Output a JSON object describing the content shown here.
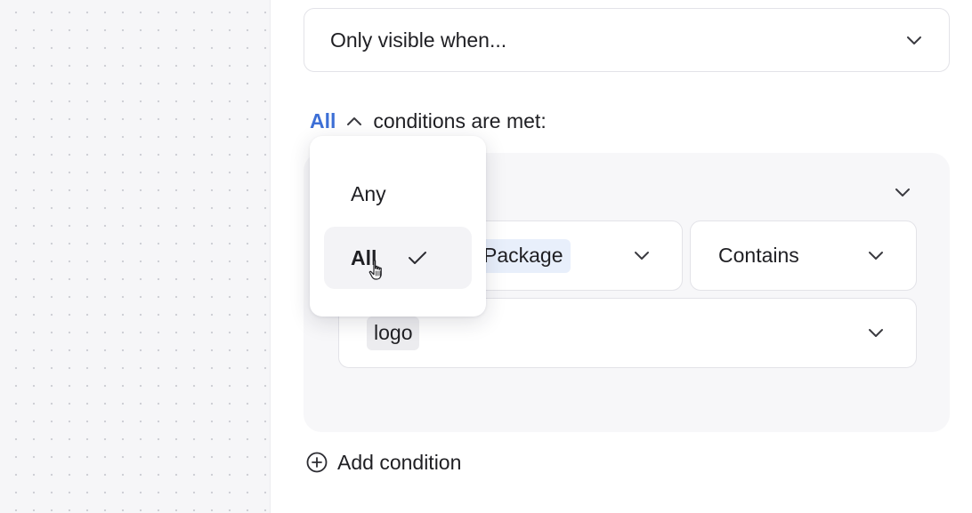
{
  "visibility": {
    "label": "Only visible when...",
    "icon": "chevron-down-icon"
  },
  "conditions": {
    "mode": "All",
    "mode_icon": "chevron-up-icon",
    "suffix": "conditions are met:"
  },
  "match_menu": {
    "options": [
      {
        "label": "Any",
        "selected": false
      },
      {
        "label": "All",
        "selected": true
      }
    ],
    "selected_icon": "check-icon"
  },
  "condition": {
    "property": "Package",
    "operator": "Contains",
    "value": "logo"
  },
  "add_condition": {
    "label": "Add condition",
    "icon": "plus-circle-icon"
  },
  "colors": {
    "accent": "#3d6fd6",
    "panel": "#f6f6f8",
    "card": "#f7f7f9",
    "chip_blue": "#e8effb",
    "chip_gray": "#ececef"
  }
}
